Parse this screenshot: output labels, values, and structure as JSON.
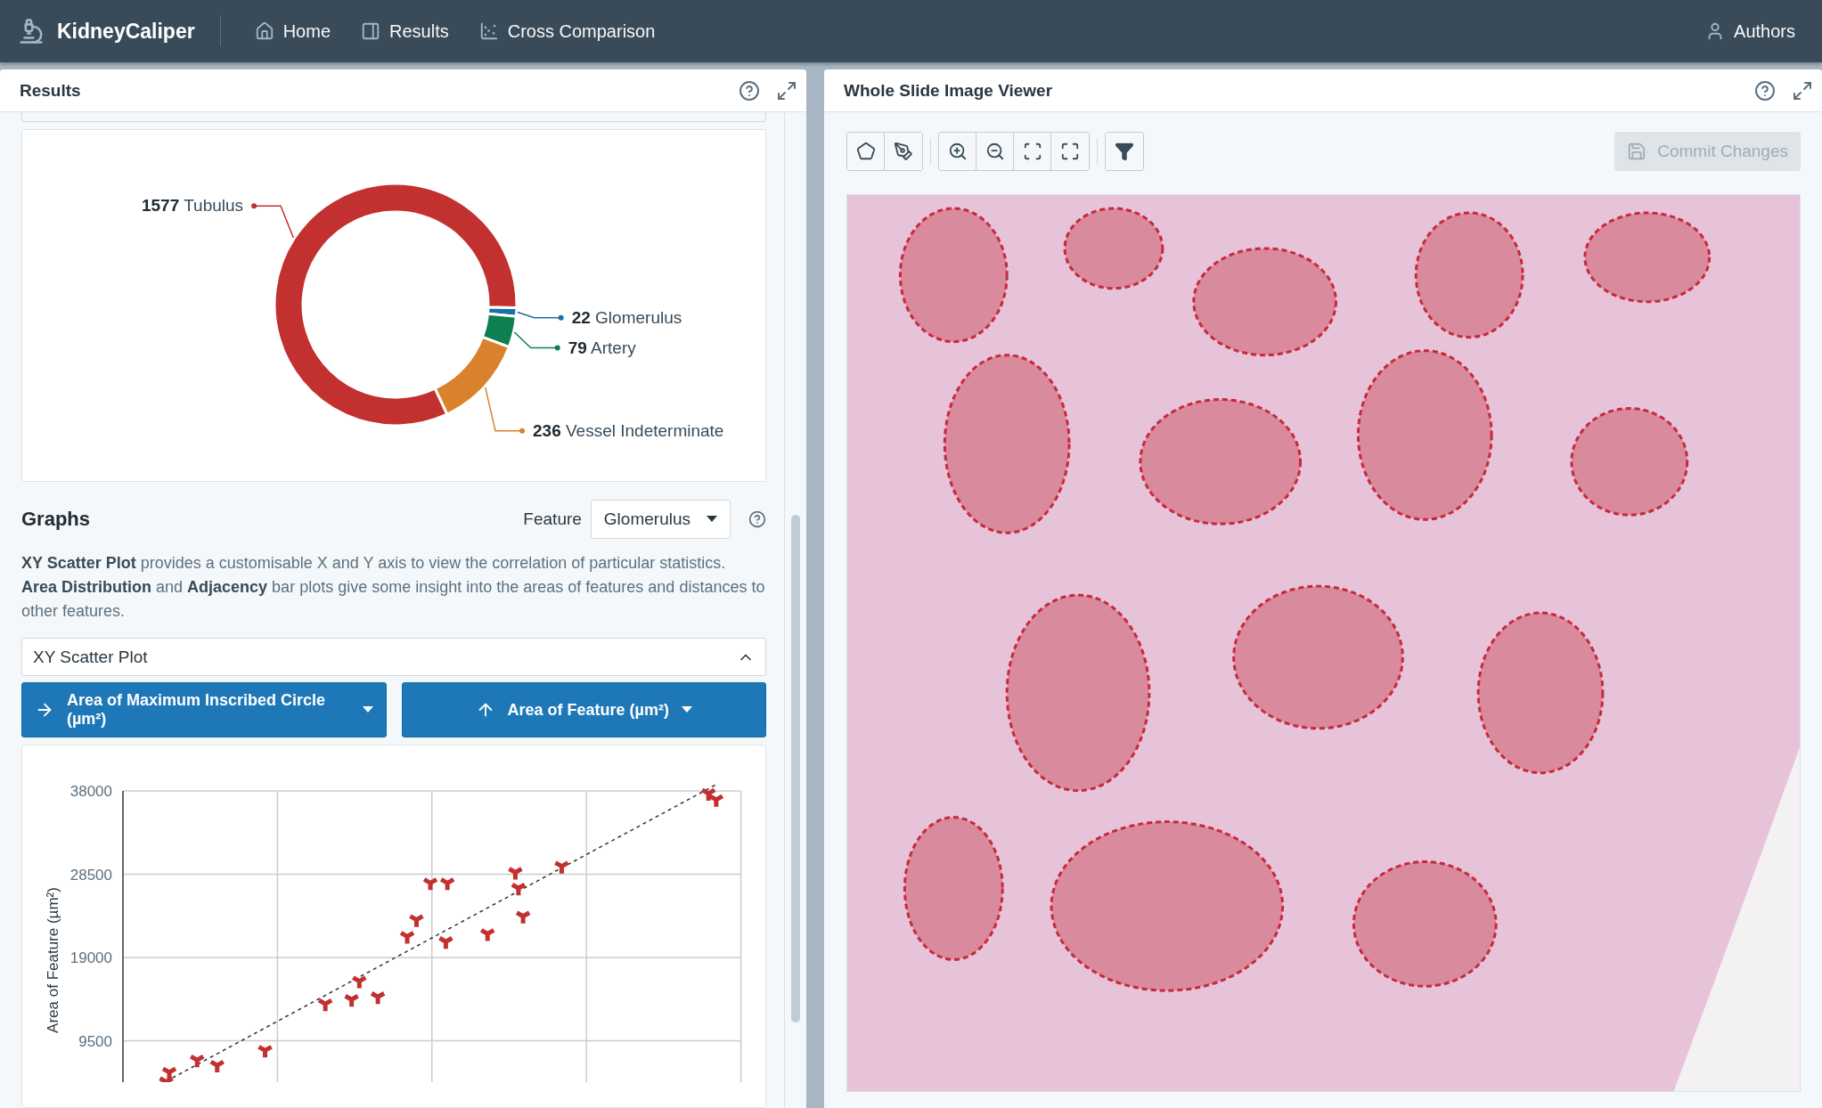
{
  "navbar": {
    "brand": "KidneyCaliper",
    "links": [
      {
        "kind": "home",
        "label": "Home"
      },
      {
        "kind": "results",
        "label": "Results"
      },
      {
        "kind": "comparison",
        "label": "Cross Comparison"
      }
    ],
    "user_menu": {
      "label": "Authors"
    }
  },
  "results_panel": {
    "title": "Results",
    "donut": {
      "chart_data": {
        "type": "donut",
        "categories": [
          "Glomerulus",
          "Artery",
          "Vessel Indeterminate",
          "Tubulus"
        ],
        "values": [
          22,
          79,
          236,
          1577
        ],
        "colors": [
          "#1a6fad",
          "#0e8050",
          "#d9822b",
          "#c23030"
        ],
        "data_labels": true,
        "legend": true
      }
    },
    "graphs": {
      "heading": "Graphs",
      "feature_label": "Feature",
      "feature_value": "Glomerulus",
      "description": [
        "**XY Scatter Plot** provides a customisable X and Y axis to view the correlation of particular statistics.",
        "**Area Distribution** and **Adjacency** bar plots give some insight into the areas of features and distances to other features."
      ],
      "plot_type": {
        "label": "XY Scatter Plot",
        "expanded": true
      },
      "x_axis_button": "Area of Maximum Inscribed Circle (µm²)",
      "y_axis_button": "Area of Feature (µm²)",
      "scatter": {
        "kind": "scatter",
        "y_axis_title": "Area of Feature (µm²)",
        "y_ticks": [
          "38000",
          "28500",
          "19000",
          "9500"
        ]
      }
    }
  },
  "viewer_panel": {
    "title": "Whole Slide Image Viewer",
    "tool_groups": [
      {
        "tools": [
          {
            "kind": "polygon"
          },
          {
            "kind": "pen"
          }
        ]
      },
      {
        "tools": [
          {
            "kind": "zoom_in"
          },
          {
            "kind": "zoom_out"
          },
          {
            "kind": "fit"
          },
          {
            "kind": "fullscreen"
          }
        ]
      },
      {
        "tools": [
          {
            "kind": "filter"
          }
        ]
      }
    ],
    "commit_button": {
      "label": "Commit Changes",
      "disabled": true
    }
  }
}
